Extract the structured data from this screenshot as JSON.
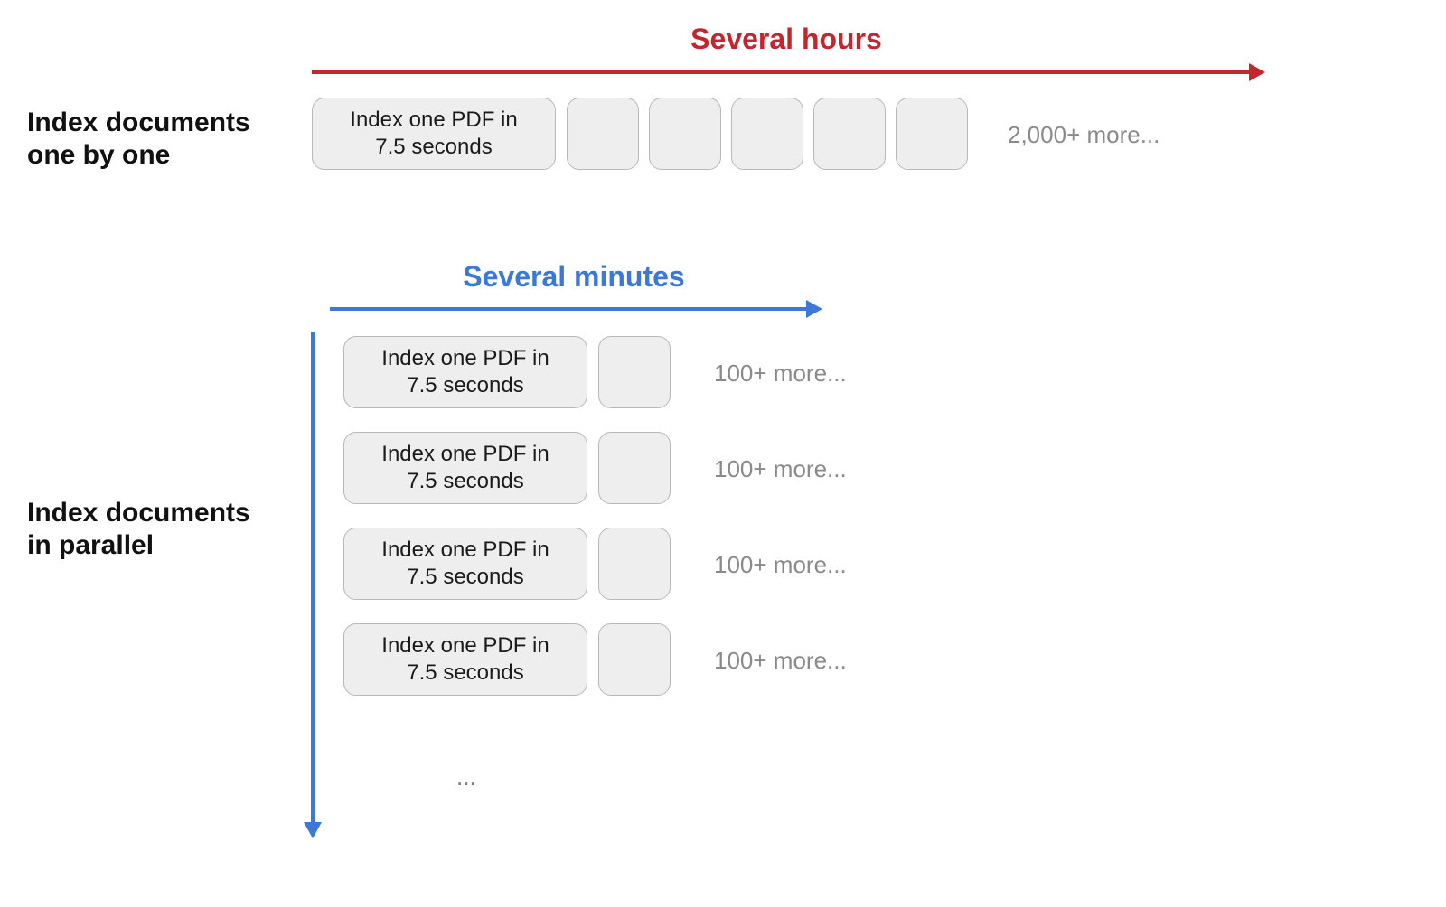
{
  "sequential": {
    "label_line1": "Index documents",
    "label_line2": "one by one",
    "headline": "Several hours",
    "task_label_line1": "Index one PDF in",
    "task_label_line2": "7.5 seconds",
    "more_text": "2,000+  more..."
  },
  "parallel": {
    "label_line1": "Index documents",
    "label_line2": "in parallel",
    "headline": "Several minutes",
    "task_label_line1": "Index one PDF in",
    "task_label_line2": "7.5 seconds",
    "lane_more_text": "100+ more...",
    "ellipsis": "..."
  },
  "colors": {
    "red": "#c1272d",
    "blue": "#3c78d8",
    "box_fill": "#eeeeee",
    "box_border": "#b8b8b8",
    "grey_text": "#8a8a8a"
  }
}
